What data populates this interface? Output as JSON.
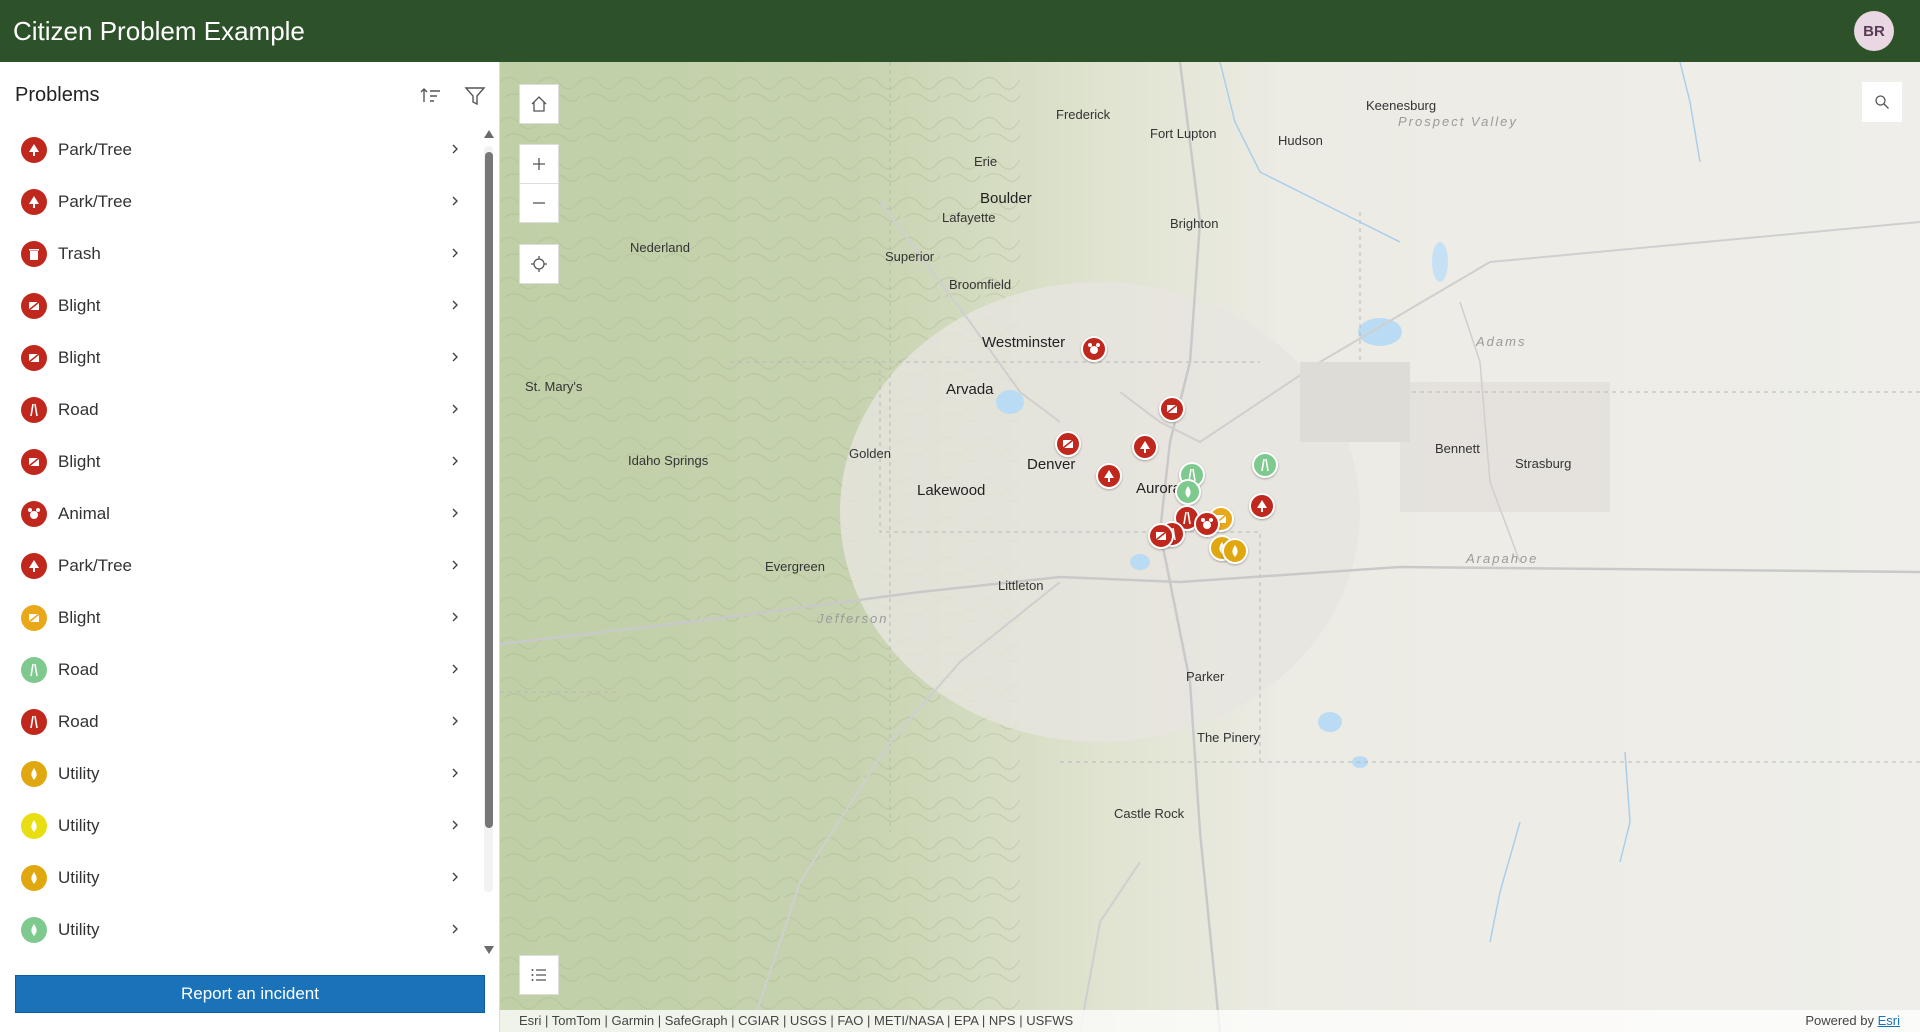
{
  "header": {
    "title": "Citizen Problem Example",
    "avatar_initials": "BR"
  },
  "panel": {
    "title": "Problems",
    "sort_icon": "sort-icon",
    "filter_icon": "filter-icon",
    "items": [
      {
        "label": "Park/Tree",
        "icon": "tree-icon",
        "color": "#c0271d"
      },
      {
        "label": "Park/Tree",
        "icon": "tree-icon",
        "color": "#c0271d"
      },
      {
        "label": "Trash",
        "icon": "trash-icon",
        "color": "#c0271d"
      },
      {
        "label": "Blight",
        "icon": "blight-icon",
        "color": "#c0271d"
      },
      {
        "label": "Blight",
        "icon": "blight-icon",
        "color": "#c0271d"
      },
      {
        "label": "Road",
        "icon": "road-icon",
        "color": "#c0271d"
      },
      {
        "label": "Blight",
        "icon": "blight-icon",
        "color": "#c0271d"
      },
      {
        "label": "Animal",
        "icon": "animal-icon",
        "color": "#c0271d"
      },
      {
        "label": "Park/Tree",
        "icon": "tree-icon",
        "color": "#c0271d"
      },
      {
        "label": "Blight",
        "icon": "blight-icon",
        "color": "#e9a81a"
      },
      {
        "label": "Road",
        "icon": "road-icon",
        "color": "#7ec98e"
      },
      {
        "label": "Road",
        "icon": "road-icon",
        "color": "#c0271d"
      },
      {
        "label": "Utility",
        "icon": "utility-icon",
        "color": "#e0a70f"
      },
      {
        "label": "Utility",
        "icon": "utility-icon",
        "color": "#e9de12"
      },
      {
        "label": "Utility",
        "icon": "utility-icon",
        "color": "#e0a70f"
      },
      {
        "label": "Utility",
        "icon": "utility-icon",
        "color": "#7ec98e"
      }
    ],
    "report_button": "Report an incident"
  },
  "map": {
    "places": [
      {
        "name": "Boulder",
        "cls": "big"
      },
      {
        "name": "Frederick",
        "cls": ""
      },
      {
        "name": "Fort Lupton",
        "cls": ""
      },
      {
        "name": "Keenesburg",
        "cls": ""
      },
      {
        "name": "Hudson",
        "cls": ""
      },
      {
        "name": "Erie",
        "cls": ""
      },
      {
        "name": "Lafayette",
        "cls": ""
      },
      {
        "name": "Brighton",
        "cls": ""
      },
      {
        "name": "Nederland",
        "cls": ""
      },
      {
        "name": "Superior",
        "cls": ""
      },
      {
        "name": "Broomfield",
        "cls": ""
      },
      {
        "name": "Westminster",
        "cls": "big"
      },
      {
        "name": "Arvada",
        "cls": "big"
      },
      {
        "name": "St. Mary's",
        "cls": ""
      },
      {
        "name": "Golden",
        "cls": ""
      },
      {
        "name": "Idaho Springs",
        "cls": ""
      },
      {
        "name": "Denver",
        "cls": "big"
      },
      {
        "name": "Lakewood",
        "cls": "big"
      },
      {
        "name": "Aurora",
        "cls": "big"
      },
      {
        "name": "Bennett",
        "cls": ""
      },
      {
        "name": "Strasburg",
        "cls": ""
      },
      {
        "name": "Evergreen",
        "cls": ""
      },
      {
        "name": "Littleton",
        "cls": ""
      },
      {
        "name": "Parker",
        "cls": ""
      },
      {
        "name": "The Pinery",
        "cls": ""
      },
      {
        "name": "Castle Rock",
        "cls": ""
      },
      {
        "name": "Prospect Valley",
        "cls": "region"
      },
      {
        "name": "Adams",
        "cls": "region"
      },
      {
        "name": "Arapahoe",
        "cls": "region"
      },
      {
        "name": "Jefferson",
        "cls": "region"
      }
    ],
    "buttons": {
      "home": "home-icon",
      "zoom_in": "plus-icon",
      "zoom_out": "minus-icon",
      "locate": "locate-icon",
      "list": "list-icon",
      "search": "search-icon"
    },
    "attribution": "Esri | TomTom | Garmin | SafeGraph | CGIAR | USGS | FAO | METI/NASA | EPA | NPS | USFWS",
    "powered_by": "Powered by",
    "powered_link": "Esri"
  }
}
